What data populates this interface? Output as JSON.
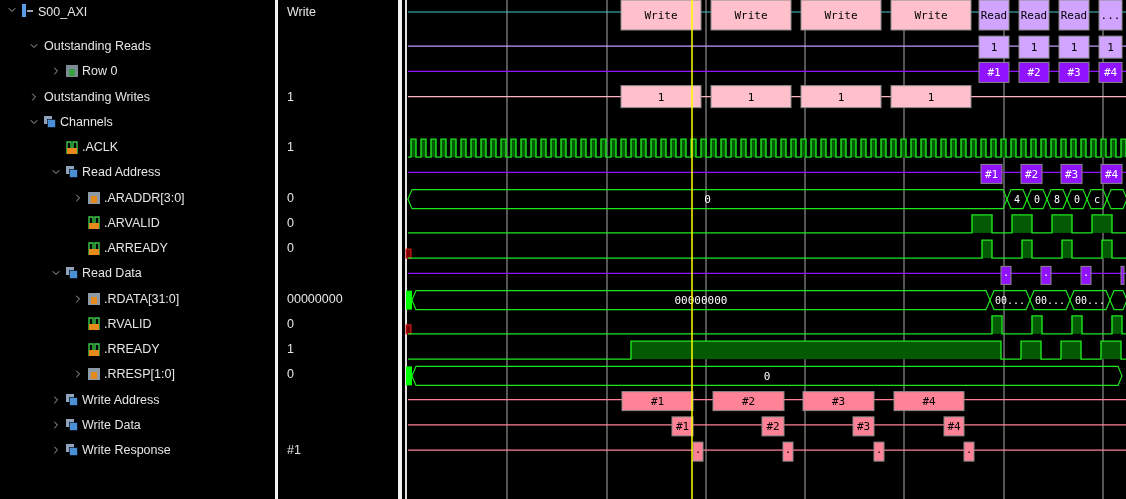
{
  "signals": [
    {
      "name": "S00_AXI",
      "kind": "interface",
      "expanded": true,
      "value": "Write",
      "wave_labels": [
        "Write",
        "Write",
        "Write",
        "Write",
        "Read",
        "Read",
        "Read",
        "..."
      ],
      "children": [
        {
          "name": "Outstanding Reads",
          "kind": "counter",
          "expanded": true,
          "wave_labels": [
            "1",
            "1",
            "1",
            "1"
          ],
          "children": [
            {
              "name": "Row 0",
              "kind": "row",
              "expanded": false,
              "wave_labels": [
                "#1",
                "#2",
                "#3",
                "#4"
              ]
            }
          ]
        },
        {
          "name": "Outstanding Writes",
          "kind": "counter",
          "expanded": false,
          "value": "1",
          "wave_labels": [
            "1",
            "1",
            "1",
            "1"
          ]
        },
        {
          "name": "Channels",
          "kind": "channel",
          "expanded": true,
          "children": [
            {
              "name": ".ACLK",
              "kind": "clock",
              "value": "1"
            },
            {
              "name": "Read Address",
              "kind": "channel",
              "expanded": true,
              "wave_labels": [
                "#1",
                "#2",
                "#3",
                "#4"
              ],
              "children": [
                {
                  "name": ".ARADDR[3:0]",
                  "kind": "bus",
                  "expanded": false,
                  "value": "0",
                  "wave_labels": [
                    "0",
                    "4",
                    "0",
                    "8",
                    "0",
                    "c"
                  ]
                },
                {
                  "name": ".ARVALID",
                  "kind": "bit",
                  "value": "0"
                },
                {
                  "name": ".ARREADY",
                  "kind": "bit",
                  "value": "0"
                }
              ]
            },
            {
              "name": "Read Data",
              "kind": "channel",
              "expanded": true,
              "wave_labels": [
                "·",
                "·",
                "·"
              ],
              "children": [
                {
                  "name": ".RDATA[31:0]",
                  "kind": "bus",
                  "expanded": false,
                  "value": "00000000",
                  "wave_labels": [
                    "00000000",
                    "00...",
                    "00...",
                    "00..."
                  ]
                },
                {
                  "name": ".RVALID",
                  "kind": "bit",
                  "value": "0"
                },
                {
                  "name": ".RREADY",
                  "kind": "bit",
                  "value": "1"
                },
                {
                  "name": ".RRESP[1:0]",
                  "kind": "bus",
                  "expanded": false,
                  "value": "0",
                  "wave_labels": [
                    "0"
                  ]
                }
              ]
            },
            {
              "name": "Write Address",
              "kind": "channel",
              "expanded": false,
              "wave_labels": [
                "#1",
                "#2",
                "#3",
                "#4"
              ]
            },
            {
              "name": "Write Data",
              "kind": "channel",
              "expanded": false,
              "wave_labels": [
                "#1",
                "#2",
                "#3",
                "#4"
              ]
            },
            {
              "name": "Write Response",
              "kind": "channel",
              "expanded": false,
              "value": "#1",
              "wave_labels": [
                "·",
                "·",
                "·",
                "·"
              ]
            }
          ]
        }
      ]
    }
  ]
}
